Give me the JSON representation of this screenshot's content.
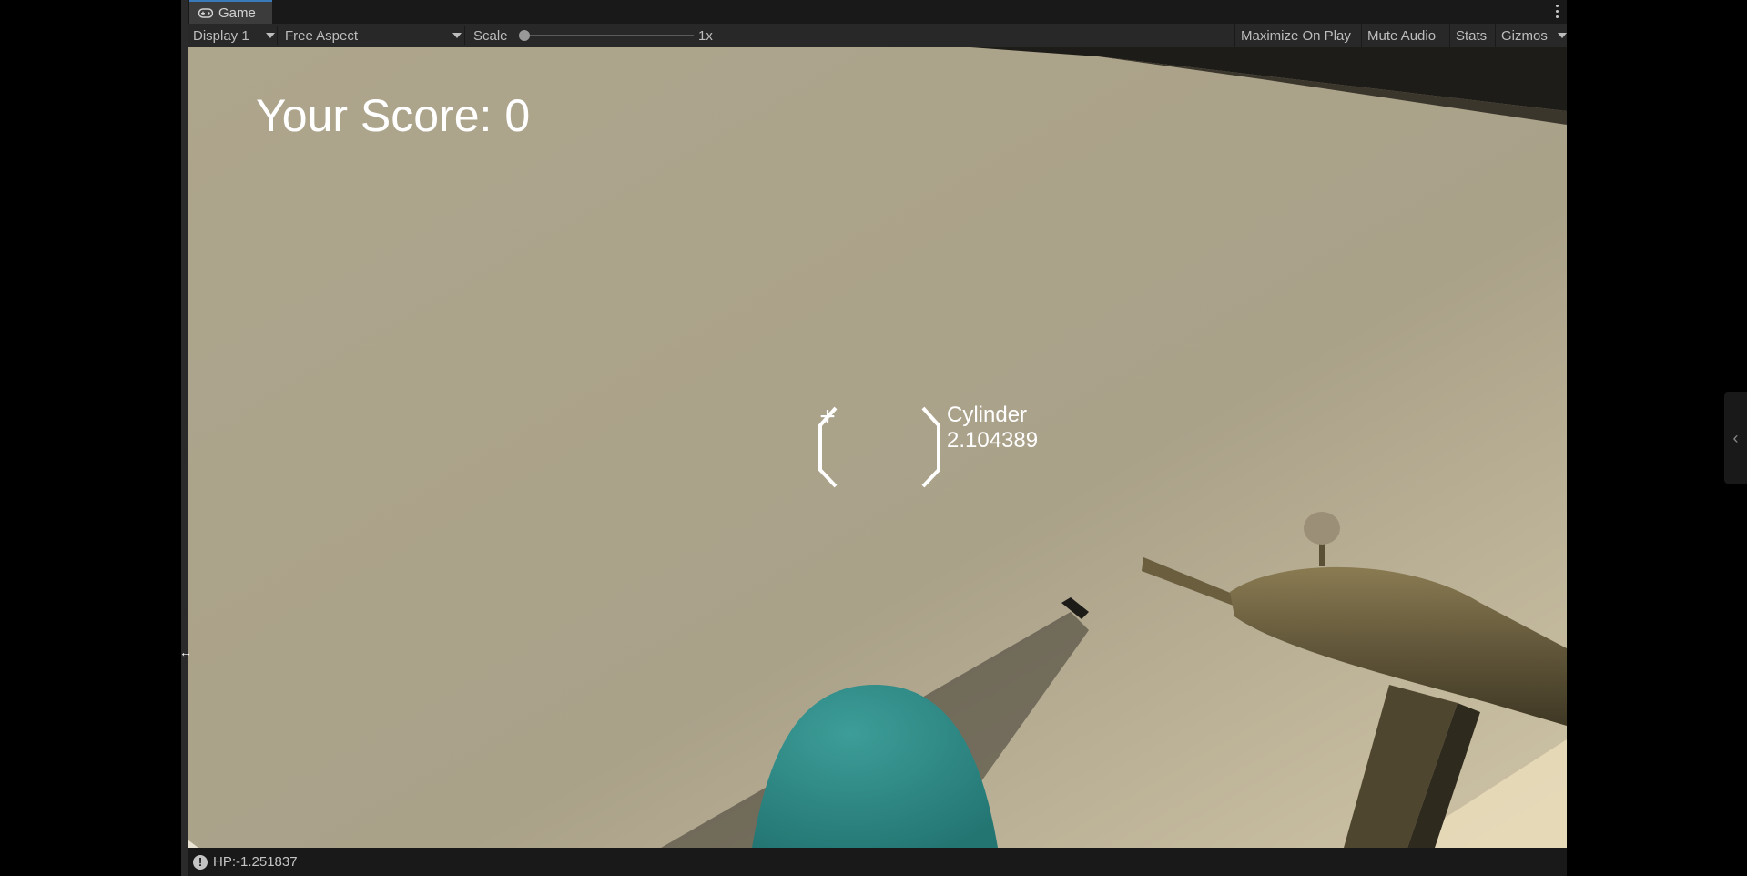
{
  "tab": {
    "label": "Game",
    "icon": "gamepad-icon"
  },
  "toolbar": {
    "display": "Display 1",
    "aspect": "Free Aspect",
    "scale_label": "Scale",
    "scale_value": "1x",
    "scale_level": 0.0,
    "maximize": "Maximize On Play",
    "mute": "Mute Audio",
    "stats": "Stats",
    "gizmos": "Gizmos"
  },
  "hud": {
    "score": "Your Score: 0",
    "crosshair": "+",
    "target_name": "Cylinder",
    "target_distance": "2.104389"
  },
  "status": {
    "message": "HP:-1.251837",
    "icon": "warning-icon"
  },
  "colors": {
    "accent": "#3a79bb",
    "editor_bg": "#191919",
    "toolbar_bg": "#282828",
    "sky": "#a69d85",
    "teal_object": "#2f8a86",
    "gun": "#6b5f3e"
  }
}
